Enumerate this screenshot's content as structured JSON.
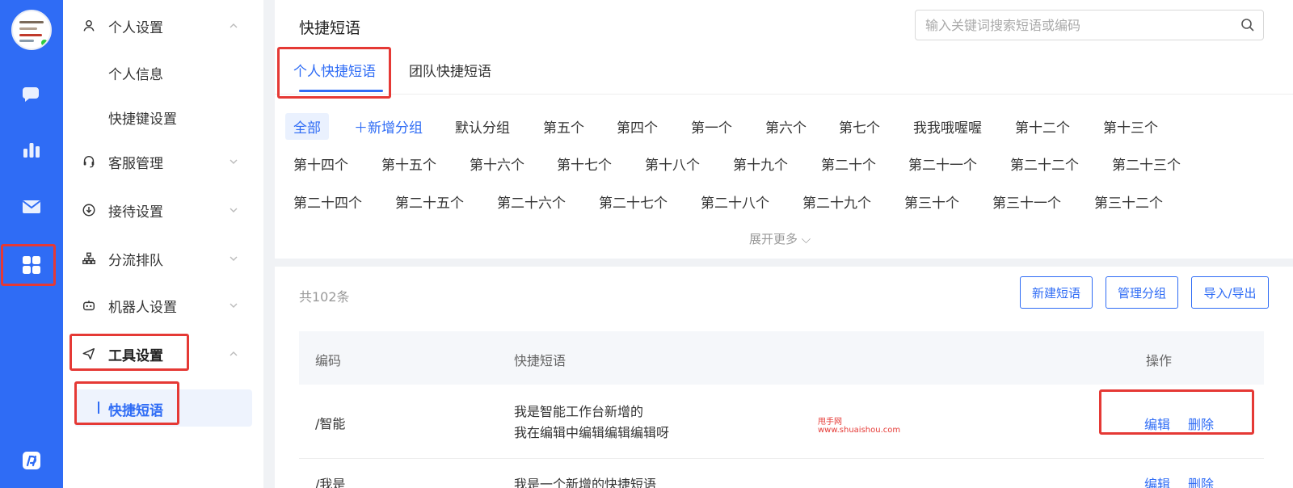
{
  "rail": {
    "colors": {
      "bg": "#2f6cf5",
      "highlight": "#e53935",
      "online": "#2ecc40"
    },
    "items": [
      {
        "icon": "chat-bubble-icon"
      },
      {
        "icon": "bar-chart-icon"
      },
      {
        "icon": "mail-icon"
      },
      {
        "icon": "apps-grid-icon",
        "active": true
      },
      {
        "icon": "brand-logo-icon"
      }
    ]
  },
  "sidebar": {
    "groups": [
      {
        "label": "个人设置",
        "icon": "user-icon",
        "expanded": true,
        "subs": [
          "个人信息",
          "快捷键设置"
        ]
      },
      {
        "label": "客服管理",
        "icon": "headset-icon",
        "expanded": false
      },
      {
        "label": "接待设置",
        "icon": "download-circle-icon",
        "expanded": false
      },
      {
        "label": "分流排队",
        "icon": "hierarchy-icon",
        "expanded": false
      },
      {
        "label": "机器人设置",
        "icon": "robot-icon",
        "expanded": false
      },
      {
        "label": "工具设置",
        "icon": "send-icon",
        "expanded": true,
        "active": true,
        "subs": [
          "快捷短语"
        ]
      }
    ]
  },
  "main": {
    "title": "快捷短语",
    "search": {
      "placeholder": "输入关键词搜索短语或编码",
      "value": ""
    },
    "tabs": [
      {
        "label": "个人快捷短语",
        "active": true
      },
      {
        "label": "团队快捷短语",
        "active": false
      }
    ],
    "tag_rows": [
      [
        "全部",
        "＋新增分组",
        "默认分组",
        "第五个",
        "第四个",
        "第一个",
        "第六个",
        "第七个",
        "我我哦喔喔",
        "第十二个",
        "第十三个"
      ],
      [
        "第十四个",
        "第十五个",
        "第十六个",
        "第十七个",
        "第十八个",
        "第十九个",
        "第二十个",
        "第二十一个",
        "第二十二个",
        "第二十三个"
      ],
      [
        "第二十四个",
        "第二十五个",
        "第二十六个",
        "第二十七个",
        "第二十八个",
        "第二十九个",
        "第三十个",
        "第三十一个",
        "第三十二个"
      ]
    ],
    "expand_label": "展开更多 ⌵",
    "count_label": "共102条",
    "buttons": [
      "新建短语",
      "管理分组",
      "导入/导出"
    ],
    "table": {
      "headers": [
        "编码",
        "快捷短语",
        "操作"
      ],
      "rows": [
        {
          "code": "/智能",
          "phrase": [
            "我是智能工作台新增的",
            "我在编辑中编辑编辑编辑呀"
          ],
          "actions": [
            "编辑",
            "删除"
          ]
        },
        {
          "code": "/我是",
          "phrase": [
            "我是一个新增的快捷短语"
          ],
          "actions": [
            "编辑",
            "删除"
          ]
        }
      ]
    },
    "watermark": [
      "甩手网",
      "www.shuaishou.com"
    ],
    "colors": {
      "accent": "#2f6cf5",
      "highlight": "#e53935"
    }
  }
}
